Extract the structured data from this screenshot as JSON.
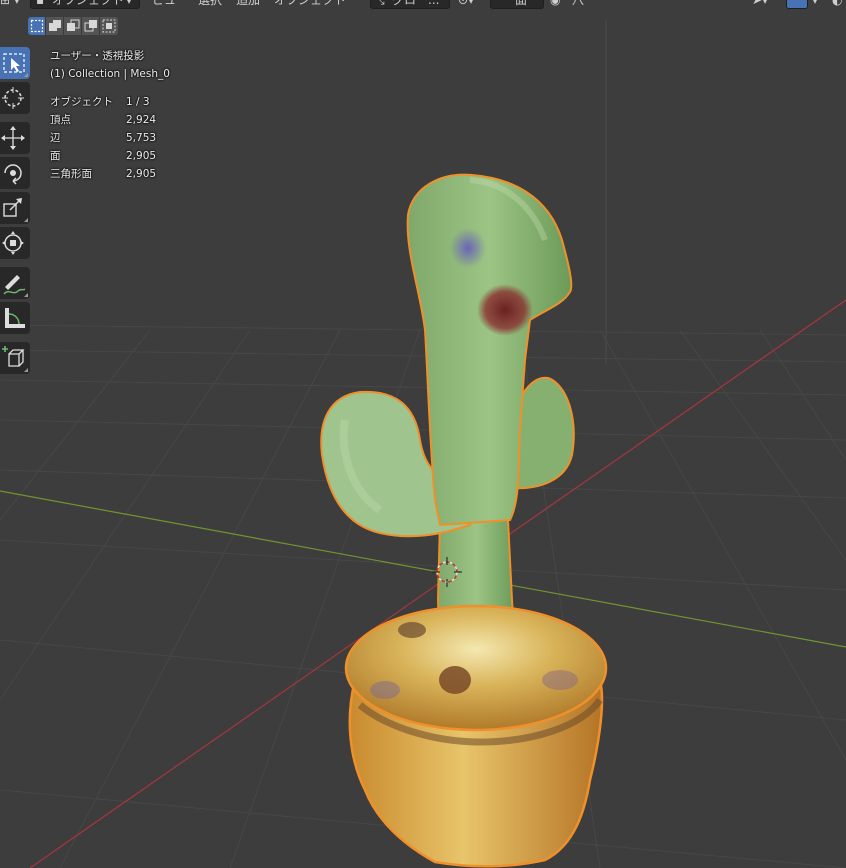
{
  "header": {
    "mode_label": "オブジェクト",
    "menus": [
      "ビュー",
      "選択",
      "追加",
      "オブジェクト"
    ],
    "transform_orientation": "グロー...",
    "snap_label": "面",
    "proportional_label": "八"
  },
  "viewport_info": {
    "view_name": "ユーザー・透視投影",
    "collection": "(1) Collection | Mesh_0"
  },
  "statistics": [
    {
      "label": "オブジェクト",
      "value": "1 / 3"
    },
    {
      "label": "頂点",
      "value": "2,924"
    },
    {
      "label": "辺",
      "value": "5,753"
    },
    {
      "label": "面",
      "value": "2,905"
    },
    {
      "label": "三角形面",
      "value": "2,905"
    }
  ],
  "toolbar": {
    "tools": [
      "select-box",
      "cursor",
      "move",
      "rotate",
      "scale",
      "transform",
      "annotate",
      "measure",
      "add-cube"
    ],
    "active_tool": "select-box"
  },
  "colors": {
    "background": "#3d3d3d",
    "accent": "#4772b3",
    "selection_outline": "#f0902a",
    "x_axis": "#a8353f",
    "y_axis": "#6d9631"
  },
  "scene": {
    "object": "cactus-in-pot mesh",
    "selected": true
  }
}
